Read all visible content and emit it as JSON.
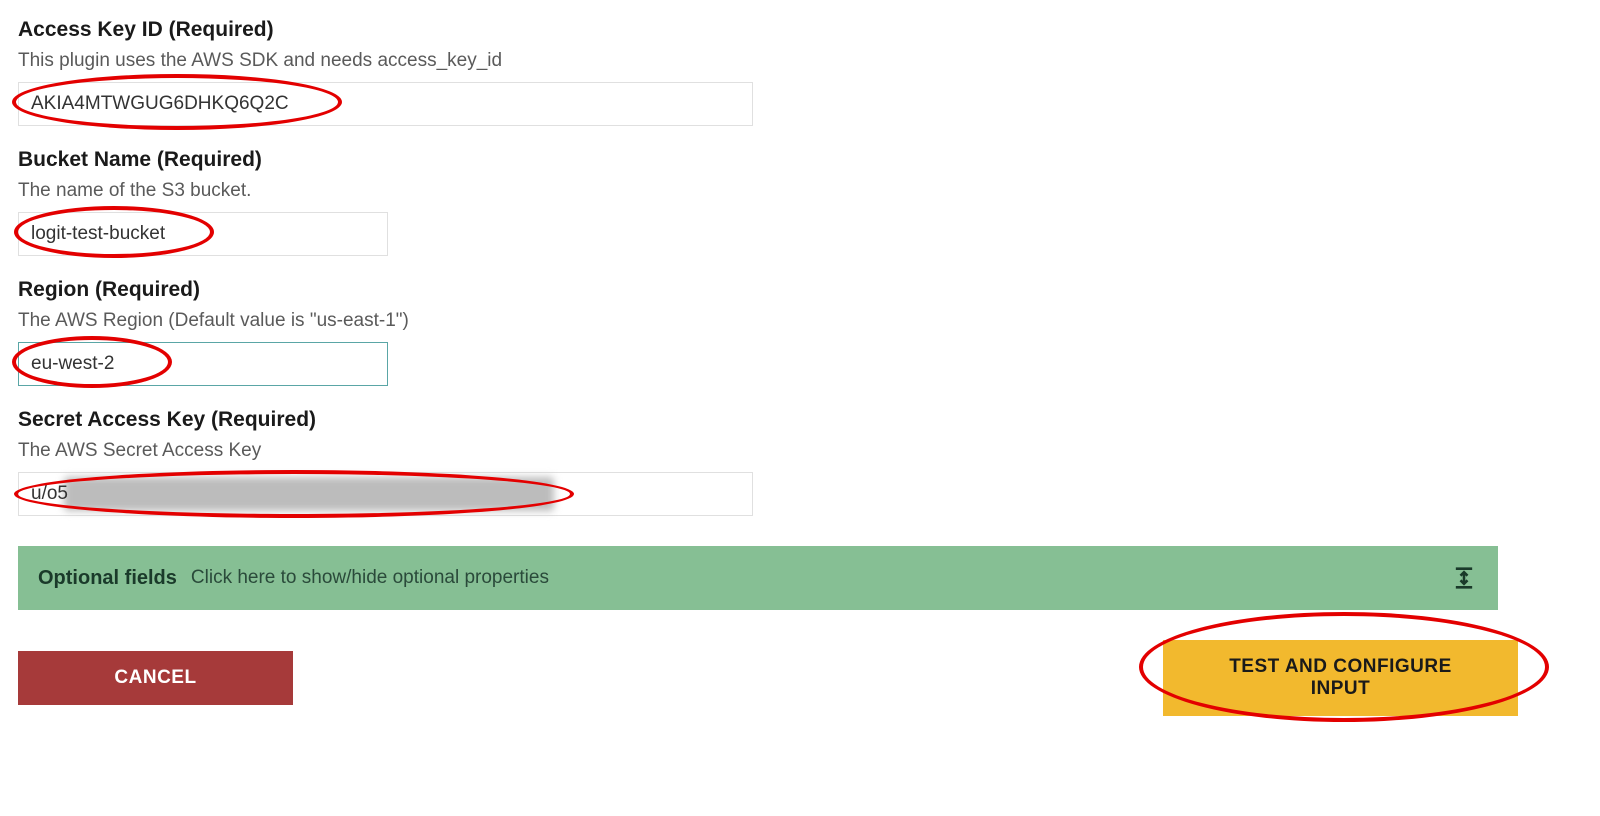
{
  "fields": {
    "accessKeyId": {
      "label": "Access Key ID (Required)",
      "description": "This plugin uses the AWS SDK and needs access_key_id",
      "value": "AKIA4MTWGUG6DHKQ6Q2C"
    },
    "bucketName": {
      "label": "Bucket Name (Required)",
      "description": "The name of the S3 bucket.",
      "value": "logit-test-bucket"
    },
    "region": {
      "label": "Region (Required)",
      "description": "The AWS Region (Default value is \"us-east-1\")",
      "value": "eu-west-2"
    },
    "secretAccessKey": {
      "label": "Secret Access Key (Required)",
      "description": "The AWS Secret Access Key",
      "visiblePrefix": "u/o5"
    }
  },
  "optional": {
    "title": "Optional fields",
    "description": "Click here to show/hide optional properties"
  },
  "buttons": {
    "cancel": "CANCEL",
    "primary": "TEST AND CONFIGURE INPUT"
  }
}
